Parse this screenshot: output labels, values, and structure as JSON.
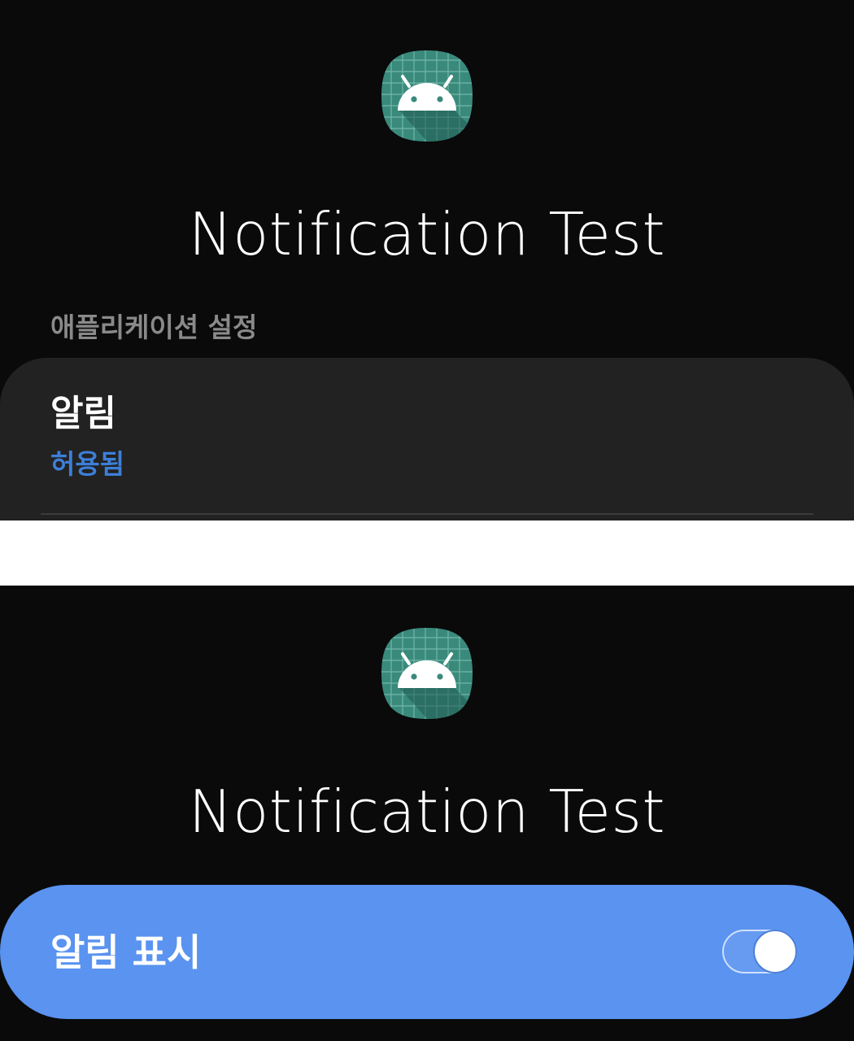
{
  "screens": [
    {
      "app_icon": "android-robot-icon",
      "app_name": "Notification Test",
      "section_header": "애플리케이션 설정",
      "notifications_item": {
        "title": "알림",
        "status": "허용됨"
      }
    },
    {
      "app_icon": "android-robot-icon",
      "app_name": "Notification Test",
      "master_switch": {
        "label": "알림 표시",
        "enabled": true
      }
    }
  ],
  "colors": {
    "background": "#0a0a0a",
    "card": "#222222",
    "accent_blue": "#3d7fd9",
    "switch_bar": "#5a93f0",
    "icon_bg": "#3a8a7c"
  }
}
